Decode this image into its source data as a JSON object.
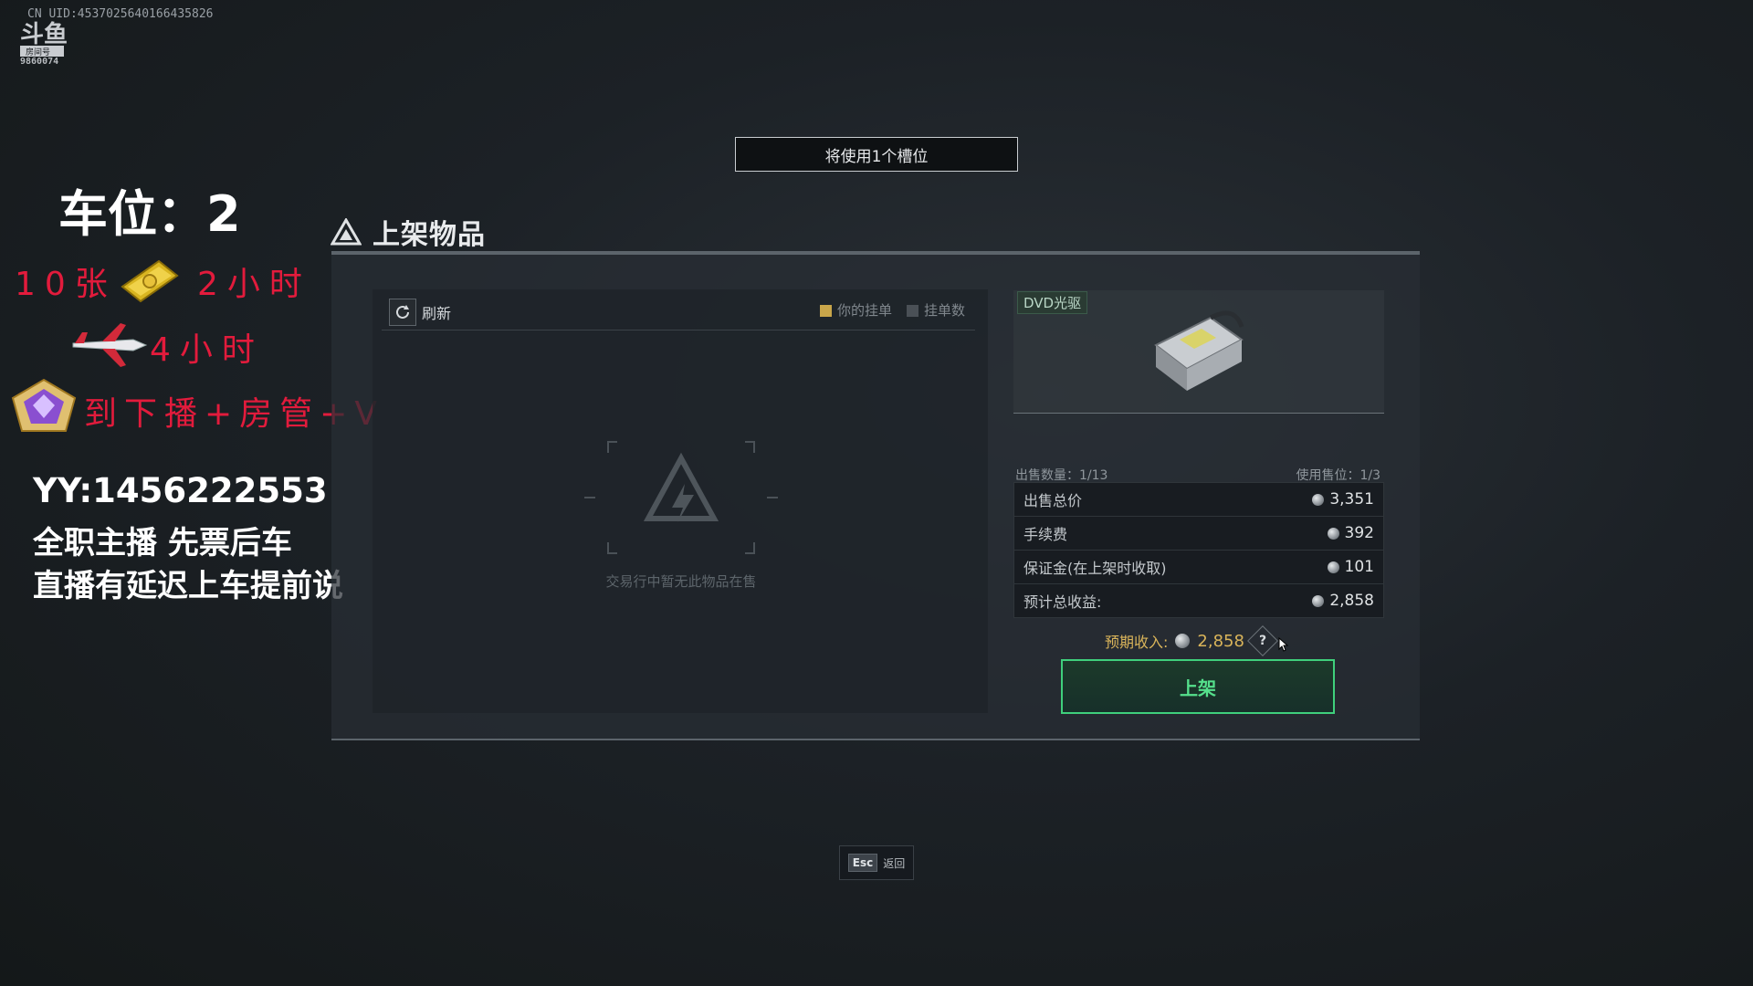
{
  "watermark": {
    "uid": "CN UID:4537025640166435826",
    "room_number": "9860074",
    "logo_text": "斗鱼 房间号"
  },
  "overlay": {
    "title": "车位：2",
    "line1_part1": "10张",
    "line1_part2": "2小时",
    "line2": "4小时",
    "line3": "到下播+房管+V",
    "yy": "YY:1456222553",
    "fulltime": "全职主播 先票后车",
    "delay": "直播有延迟上车提前说",
    "red_color": "#e21b3c"
  },
  "notice": {
    "text": "将使用1个槽位"
  },
  "panel": {
    "title": "上架物品",
    "refresh_label": "刷新",
    "legend": {
      "yours": "你的挂单",
      "count": "挂单数"
    },
    "empty_text": "交易行中暂无此物品在售"
  },
  "item": {
    "name": "DVD光驱",
    "icon": "dvd-drive-icon"
  },
  "stats": {
    "sell_qty_label": "出售数量：1/13",
    "slots_label": "使用售位：1/3"
  },
  "fees": [
    {
      "label": "出售总价",
      "value": "3,351"
    },
    {
      "label": "手续费",
      "value": "392"
    },
    {
      "label": "保证金(在上架时收取)",
      "value": "101"
    },
    {
      "label": "预计总收益:",
      "value": "2,858"
    }
  ],
  "expected": {
    "label": "预期收入:",
    "value": "2,858"
  },
  "list_button": {
    "label": "上架",
    "accent": "#3fd07c"
  },
  "footer": {
    "esc_key": "Esc",
    "esc_label": "返回"
  }
}
